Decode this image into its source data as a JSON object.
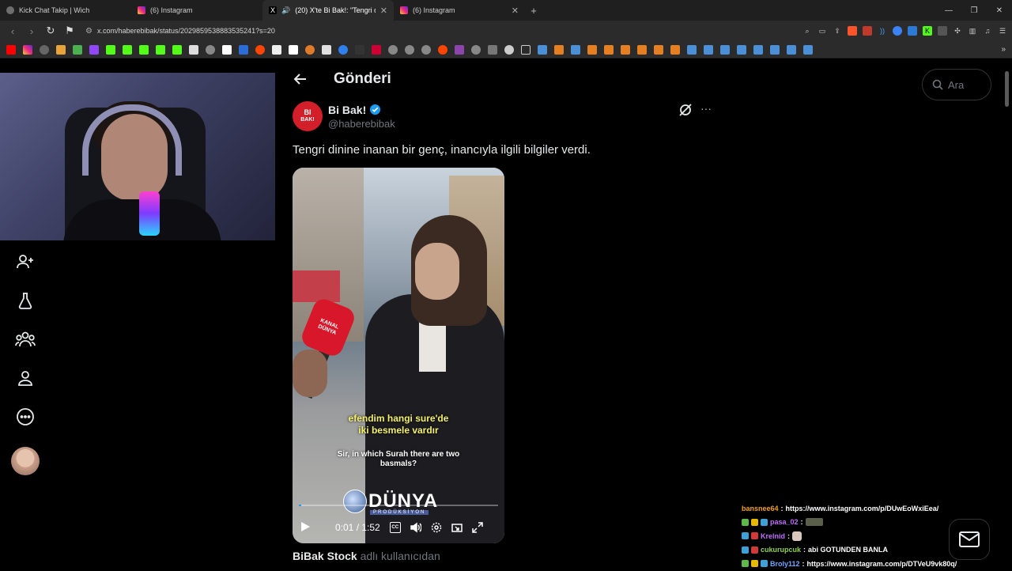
{
  "browser": {
    "tabs": [
      {
        "title": "Kick Chat Takip | Wich",
        "color": "#6e6e6e",
        "active": false
      },
      {
        "title": "(6) Instagram",
        "color": "#d62976",
        "active": false
      },
      {
        "title": "(20) X'te Bi Bak!: \"Tengri dinin",
        "color": "#000000",
        "active": true
      },
      {
        "title": "(6) Instagram",
        "color": "#d62976",
        "active": false
      }
    ],
    "url": "x.com/haberebibak/status/2029859538883535241?s=20"
  },
  "sidebar": {
    "items": [
      {
        "name": "follow-icon"
      },
      {
        "name": "grok-lab-icon"
      },
      {
        "name": "communities-icon"
      },
      {
        "name": "profile-icon"
      },
      {
        "name": "more-icon"
      }
    ]
  },
  "header": {
    "title": "Gönderi",
    "search_placeholder": "Ara"
  },
  "post": {
    "author_name": "Bi Bak!",
    "logo_line1": "BI",
    "logo_line2": "BAK!",
    "handle": "@haberebibak",
    "text": "Tengri dinine inanan bir genç, inancıyla ilgili bilgiler verdi.",
    "video": {
      "mic_label_1": "KANAL",
      "mic_label_2": "DÜNYA",
      "subtitle_tr_1": "efendim hangi sure'de",
      "subtitle_tr_2": "iki besmele vardır",
      "subtitle_en_1": "Sir, in which Surah there are two",
      "subtitle_en_2": "basmals?",
      "brand": "DÜNYA",
      "brand_sub": "PRODÜKSİYON",
      "time": "0:01 / 1:52",
      "progress": 0.01
    },
    "attribution_user": "BiBak Stock",
    "attribution_suffix": "adlı kullanıcıdan"
  },
  "chat": [
    {
      "user": "bansnee64",
      "user_color": "#f0a020",
      "message": "https://www.instagram.com/p/DUwEoWxiEea/",
      "badges": []
    },
    {
      "user": "pasa_02",
      "user_color": "#c06cff",
      "message": "",
      "badges": [
        "#5fb84a",
        "#e6b800",
        "#3fa0d8"
      ]
    },
    {
      "user": "Krelnid",
      "user_color": "#c06cff",
      "message": "",
      "badges": [
        "#3fa0d8",
        "#d23a3a"
      ]
    },
    {
      "user": "cukurupcuk",
      "user_color": "#8fd14f",
      "message": "abi GOTUNDEN BANLA",
      "badges": [
        "#3fa0d8",
        "#d23a3a"
      ]
    },
    {
      "user": "Broly112",
      "user_color": "#6ea8ff",
      "message": "https://www.instagram.com/p/DTVeU9vk80q/",
      "badges": [
        "#5fb84a",
        "#e6b800",
        "#3fa0d8"
      ]
    }
  ]
}
